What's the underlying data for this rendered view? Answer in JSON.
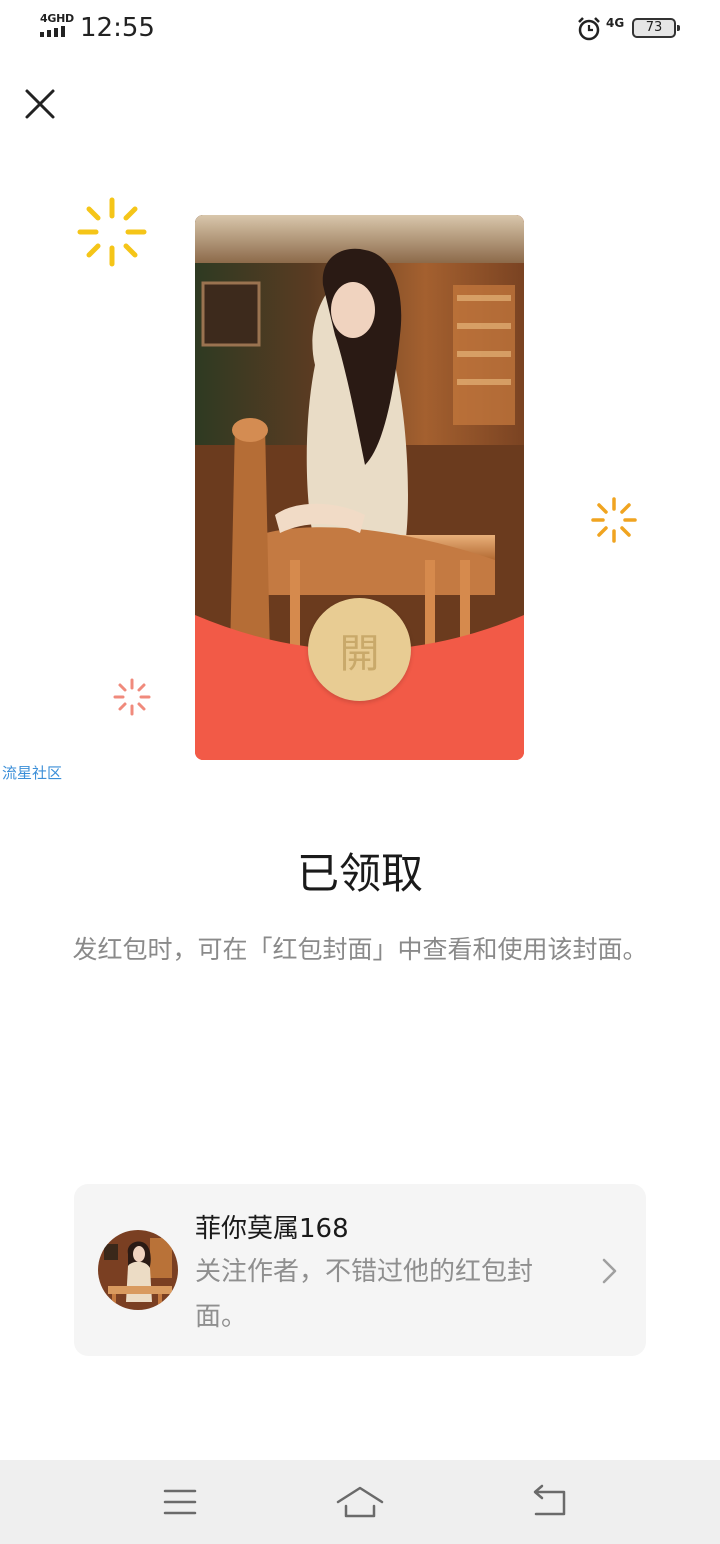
{
  "status_bar": {
    "network_type": "4GHD",
    "time": "12:55",
    "mobile_data": "4G",
    "battery_level": "73",
    "icons": [
      "signal-icon",
      "alarm-icon",
      "battery-icon"
    ]
  },
  "header": {
    "close_icon": "close-icon"
  },
  "envelope": {
    "open_char": "開",
    "background_color": "#f25a47",
    "button_color": "#e8cc93"
  },
  "watermark": "流星社区",
  "result": {
    "title": "已领取",
    "hint": "发红包时，可在「红包封面」中查看和使用该封面。"
  },
  "author": {
    "name": "菲你莫属168",
    "description": "关注作者，不错过他的红包封面。",
    "chevron_icon": "chevron-right-icon"
  },
  "nav_bar": {
    "icons": [
      "menu-icon",
      "home-icon",
      "back-icon"
    ]
  }
}
